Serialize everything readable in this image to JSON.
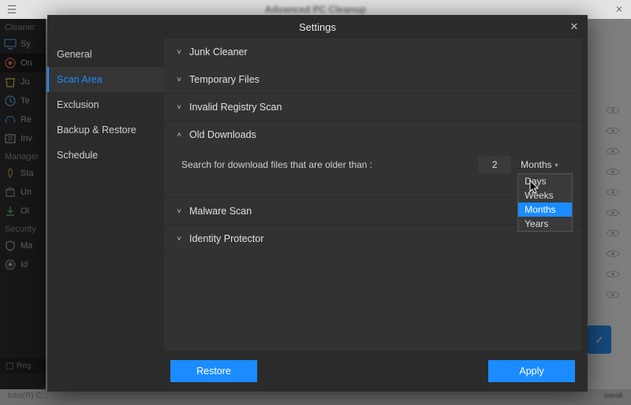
{
  "window": {
    "app_title": "Advanced PC Cleanup",
    "footer_left": "Intel(R) C...",
    "footer_right": "weak"
  },
  "left_strip": {
    "cleaner_hdr": "Cleaner",
    "items_cleaner": [
      {
        "label": "Sy"
      },
      {
        "label": "On",
        "active": true
      },
      {
        "label": "Ju"
      },
      {
        "label": "Te"
      },
      {
        "label": "Re"
      },
      {
        "label": "Inv"
      }
    ],
    "manager_hdr": "Manager",
    "items_manager": [
      {
        "label": "Sta"
      },
      {
        "label": "Un"
      },
      {
        "label": "Ol"
      }
    ],
    "security_hdr": "Security",
    "items_security": [
      {
        "label": "Ma"
      },
      {
        "label": "Id",
        "dl": true
      }
    ],
    "register": "Reg"
  },
  "modal": {
    "title": "Settings",
    "close_glyph": "✕",
    "nav": [
      {
        "label": "General"
      },
      {
        "label": "Scan Area",
        "sel": true
      },
      {
        "label": "Exclusion"
      },
      {
        "label": "Backup & Restore"
      },
      {
        "label": "Schedule"
      }
    ],
    "accordions": {
      "junk": {
        "label": "Junk Cleaner",
        "open": false
      },
      "temp": {
        "label": "Temporary Files",
        "open": false
      },
      "registry": {
        "label": "Invalid Registry Scan",
        "open": false
      },
      "old_dl": {
        "label": "Old Downloads",
        "open": true,
        "desc": "Search for download files that are older than :",
        "value": "2",
        "unit": "Months",
        "options": [
          "Days",
          "Weeks",
          "Months",
          "Years"
        ]
      },
      "malware": {
        "label": "Malware Scan",
        "open": false
      },
      "identity": {
        "label": "Identity Protector",
        "open": false
      }
    },
    "buttons": {
      "restore": "Restore",
      "apply": "Apply"
    }
  }
}
